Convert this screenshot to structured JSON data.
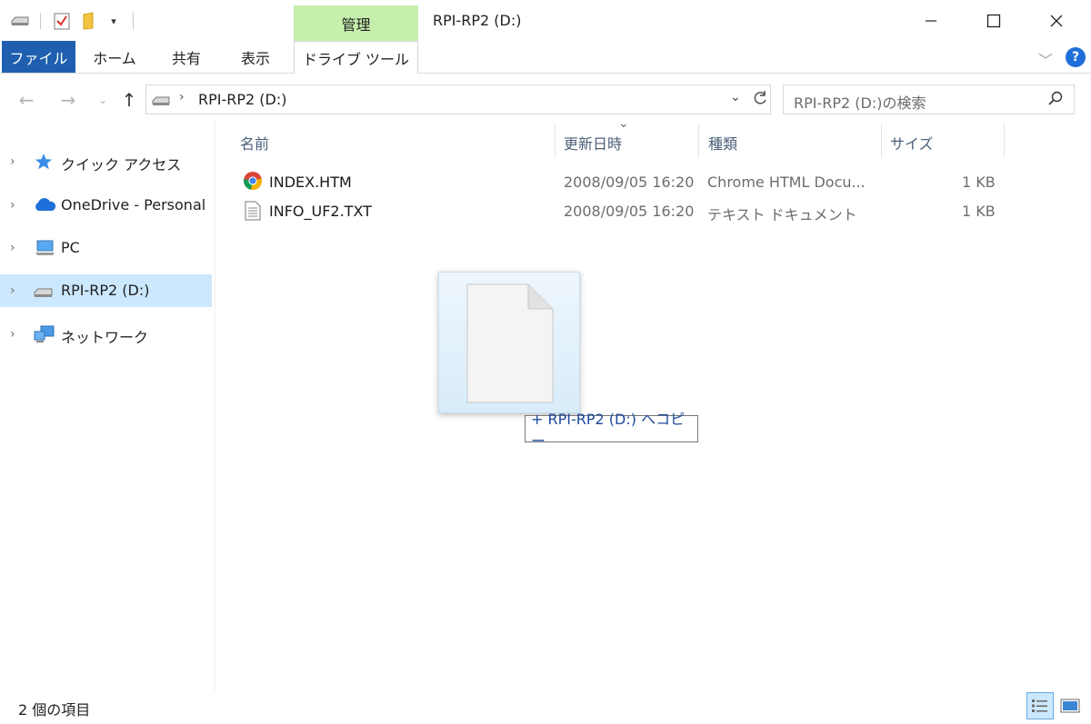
{
  "window": {
    "title": "RPI-RP2 (D:)",
    "context_tab_label": "管理"
  },
  "quick_access_toolbar": {
    "icons": [
      "drive-icon",
      "properties-check-icon",
      "new-folder-icon",
      "customize-dropdown-icon"
    ]
  },
  "ribbon": {
    "tabs": [
      {
        "label": "ファイル",
        "active": true
      },
      {
        "label": "ホーム"
      },
      {
        "label": "共有"
      },
      {
        "label": "表示"
      },
      {
        "label": "ドライブ ツール"
      }
    ]
  },
  "address": {
    "path_label": "RPI-RP2 (D:)",
    "search_placeholder": "RPI-RP2 (D:)の検索"
  },
  "navigation": {
    "items": [
      {
        "label": "クイック アクセス",
        "icon": "star-icon"
      },
      {
        "label": "OneDrive - Personal",
        "icon": "cloud-icon"
      },
      {
        "label": "PC",
        "icon": "computer-icon"
      },
      {
        "label": "RPI-RP2 (D:)",
        "icon": "drive-icon",
        "selected": true
      },
      {
        "label": "ネットワーク",
        "icon": "network-icon"
      }
    ]
  },
  "file_list": {
    "columns": [
      "名前",
      "更新日時",
      "種類",
      "サイズ"
    ],
    "rows": [
      {
        "name": "INDEX.HTM",
        "modified": "2008/09/05 16:20",
        "type": "Chrome HTML Docu...",
        "size": "1 KB",
        "icon": "chrome-icon"
      },
      {
        "name": "INFO_UF2.TXT",
        "modified": "2008/09/05 16:20",
        "type": "テキスト ドキュメント",
        "size": "1 KB",
        "icon": "text-file-icon"
      }
    ]
  },
  "drag": {
    "tooltip": "+ RPI-RP2 (D:) へコピー"
  },
  "status_bar": {
    "item_count": "2 個の項目"
  },
  "colors": {
    "file_tab": "#1e5fb0",
    "context_tab": "#c6efae",
    "selection": "#cce8ff"
  }
}
